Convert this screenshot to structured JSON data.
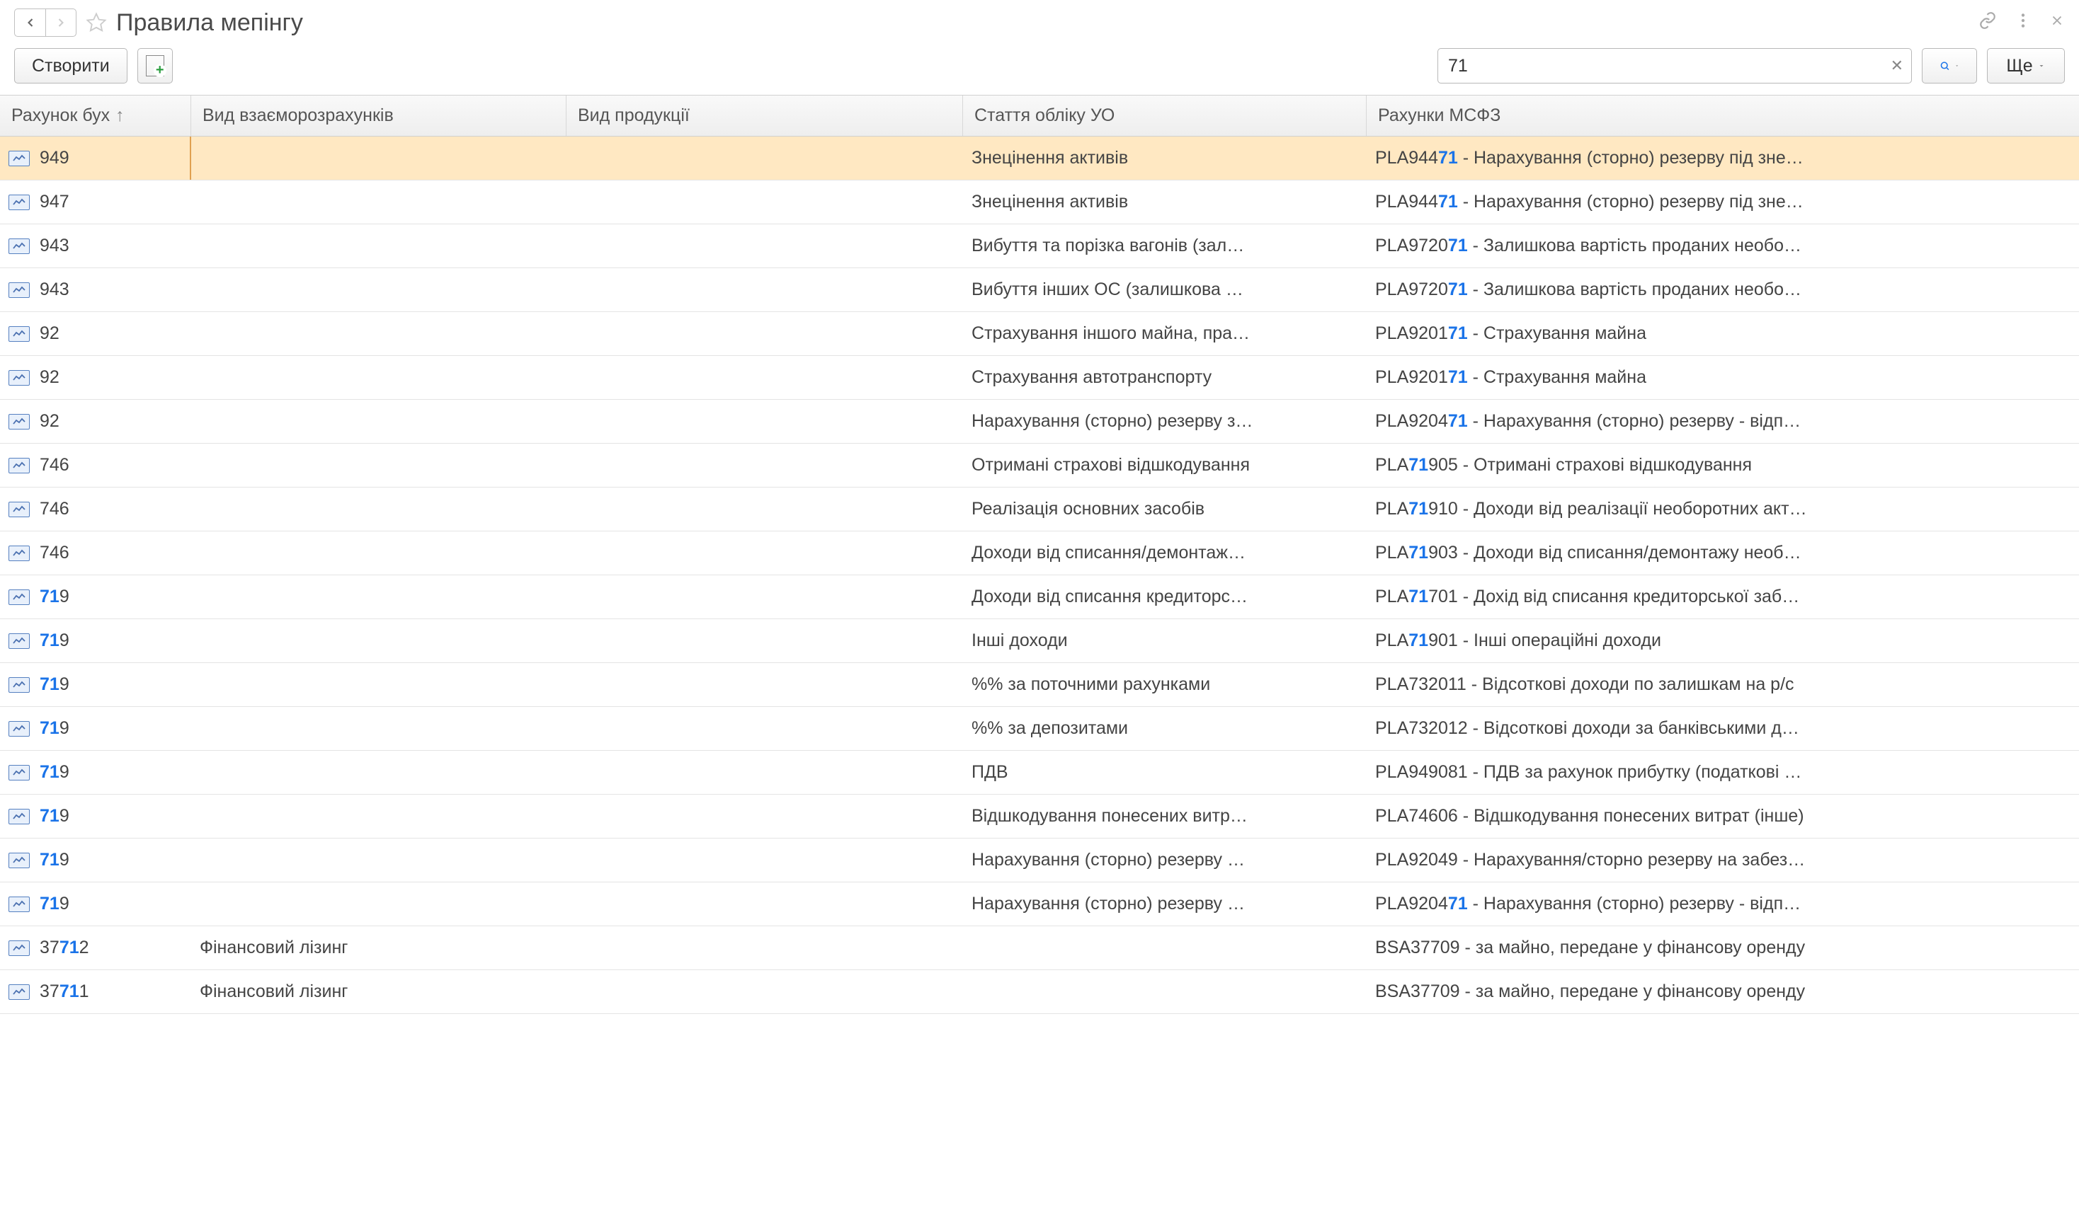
{
  "header": {
    "title": "Правила мепінгу",
    "create_label": "Створити",
    "more_label": "Ще",
    "search_value": "71"
  },
  "columns": {
    "account": "Рахунок бух",
    "settlement": "Вид взаєморозрахунків",
    "product": "Вид продукції",
    "article": "Стаття обліку УО",
    "ifrs": "Рахунки МСФЗ"
  },
  "rows": [
    {
      "account_prefix": "949",
      "account_hl": "",
      "account_suffix": "",
      "settlement": "",
      "article": "Знецінення активів",
      "ifrs_prefix": "PLA944",
      "ifrs_hl": "71",
      "ifrs_suffix": " - Нарахування (сторно) резерву під зне…"
    },
    {
      "account_prefix": "947",
      "account_hl": "",
      "account_suffix": "",
      "settlement": "",
      "article": "Знецінення активів",
      "ifrs_prefix": "PLA944",
      "ifrs_hl": "71",
      "ifrs_suffix": " - Нарахування (сторно) резерву під зне…"
    },
    {
      "account_prefix": "943",
      "account_hl": "",
      "account_suffix": "",
      "settlement": "",
      "article": "Вибуття та порізка вагонів (зал…",
      "ifrs_prefix": "PLA9720",
      "ifrs_hl": "71",
      "ifrs_suffix": " - Залишкова вартість проданих необо…"
    },
    {
      "account_prefix": "943",
      "account_hl": "",
      "account_suffix": "",
      "settlement": "",
      "article": "Вибуття інших ОС (залишкова …",
      "ifrs_prefix": "PLA9720",
      "ifrs_hl": "71",
      "ifrs_suffix": " - Залишкова вартість проданих необо…"
    },
    {
      "account_prefix": "92",
      "account_hl": "",
      "account_suffix": "",
      "settlement": "",
      "article": "Страхування іншого майна, пра…",
      "ifrs_prefix": "PLA9201",
      "ifrs_hl": "71",
      "ifrs_suffix": " - Страхування майна"
    },
    {
      "account_prefix": "92",
      "account_hl": "",
      "account_suffix": "",
      "settlement": "",
      "article": "Страхування автотранспорту",
      "ifrs_prefix": "PLA9201",
      "ifrs_hl": "71",
      "ifrs_suffix": " - Страхування майна"
    },
    {
      "account_prefix": "92",
      "account_hl": "",
      "account_suffix": "",
      "settlement": "",
      "article": "Нарахування (сторно) резерву з…",
      "ifrs_prefix": "PLA9204",
      "ifrs_hl": "71",
      "ifrs_suffix": " - Нарахування (сторно) резерву - відп…"
    },
    {
      "account_prefix": "746",
      "account_hl": "",
      "account_suffix": "",
      "settlement": "",
      "article": "Отримані страхові відшкодування",
      "ifrs_prefix": "PLA",
      "ifrs_hl": "71",
      "ifrs_suffix": "905 - Отримані страхові відшкодування"
    },
    {
      "account_prefix": "746",
      "account_hl": "",
      "account_suffix": "",
      "settlement": "",
      "article": "Реалізація основних засобів",
      "ifrs_prefix": "PLA",
      "ifrs_hl": "71",
      "ifrs_suffix": "910 - Доходи від реалізації необоротних акт…"
    },
    {
      "account_prefix": "746",
      "account_hl": "",
      "account_suffix": "",
      "settlement": "",
      "article": "Доходи від списання/демонтаж…",
      "ifrs_prefix": "PLA",
      "ifrs_hl": "71",
      "ifrs_suffix": "903 - Доходи від списання/демонтажу необ…"
    },
    {
      "account_prefix": "",
      "account_hl": "71",
      "account_suffix": "9",
      "settlement": "",
      "article": "Доходи від списання кредиторс…",
      "ifrs_prefix": "PLA",
      "ifrs_hl": "71",
      "ifrs_suffix": "701 - Дохід від списання кредиторської заб…"
    },
    {
      "account_prefix": "",
      "account_hl": "71",
      "account_suffix": "9",
      "settlement": "",
      "article": "Інші доходи",
      "ifrs_prefix": "PLA",
      "ifrs_hl": "71",
      "ifrs_suffix": "901 - Інші операційні доходи"
    },
    {
      "account_prefix": "",
      "account_hl": "71",
      "account_suffix": "9",
      "settlement": "",
      "article": "%% за поточними рахунками",
      "ifrs_prefix": "PLA732011 - Відсоткові доходи по залишкам на р/с",
      "ifrs_hl": "",
      "ifrs_suffix": ""
    },
    {
      "account_prefix": "",
      "account_hl": "71",
      "account_suffix": "9",
      "settlement": "",
      "article": "%% за депозитами",
      "ifrs_prefix": "PLA732012 - Відсоткові доходи за банківськими д…",
      "ifrs_hl": "",
      "ifrs_suffix": ""
    },
    {
      "account_prefix": "",
      "account_hl": "71",
      "account_suffix": "9",
      "settlement": "",
      "article": "ПДВ",
      "ifrs_prefix": "PLA949081 - ПДВ за рахунок прибутку (податкові …",
      "ifrs_hl": "",
      "ifrs_suffix": ""
    },
    {
      "account_prefix": "",
      "account_hl": "71",
      "account_suffix": "9",
      "settlement": "",
      "article": "Відшкодування понесених витр…",
      "ifrs_prefix": "PLA74606 - Відшкодування понесених витрат (інше)",
      "ifrs_hl": "",
      "ifrs_suffix": ""
    },
    {
      "account_prefix": "",
      "account_hl": "71",
      "account_suffix": "9",
      "settlement": "",
      "article": "Нарахування (сторно) резерву …",
      "ifrs_prefix": "PLA92049 - Нарахування/сторно резерву на забез…",
      "ifrs_hl": "",
      "ifrs_suffix": ""
    },
    {
      "account_prefix": "",
      "account_hl": "71",
      "account_suffix": "9",
      "settlement": "",
      "article": "Нарахування (сторно) резерву …",
      "ifrs_prefix": "PLA9204",
      "ifrs_hl": "71",
      "ifrs_suffix": " - Нарахування (сторно) резерву - відп…"
    },
    {
      "account_prefix": "37",
      "account_hl": "71",
      "account_suffix": "2",
      "settlement": "Фінансовий лізинг",
      "article": "",
      "ifrs_prefix": "BSA37709 - за майно, передане у фінансову оренду",
      "ifrs_hl": "",
      "ifrs_suffix": ""
    },
    {
      "account_prefix": "37",
      "account_hl": "71",
      "account_suffix": "1",
      "settlement": "Фінансовий лізинг",
      "article": "",
      "ifrs_prefix": "BSA37709 - за майно, передане у фінансову оренду",
      "ifrs_hl": "",
      "ifrs_suffix": ""
    }
  ]
}
